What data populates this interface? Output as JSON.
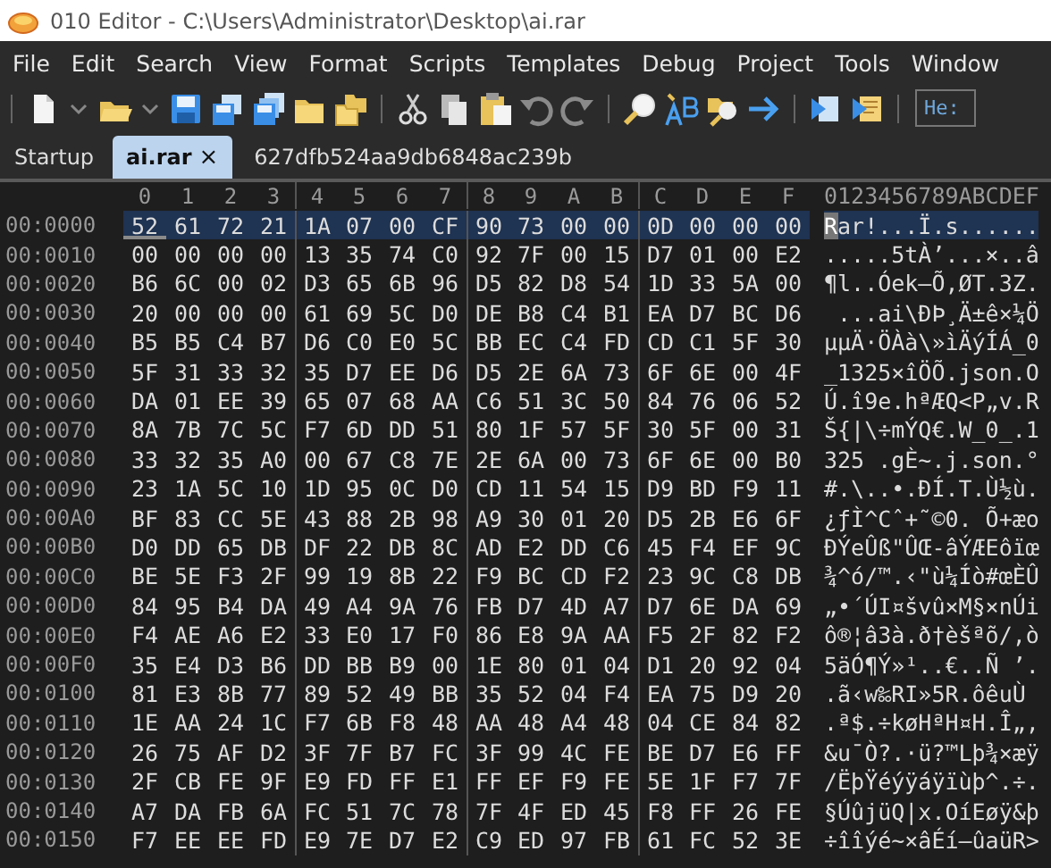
{
  "window": {
    "title": "010 Editor - C:\\Users\\Administrator\\Desktop\\ai.rar"
  },
  "menu": [
    "File",
    "Edit",
    "Search",
    "View",
    "Format",
    "Scripts",
    "Templates",
    "Debug",
    "Project",
    "Tools",
    "Window"
  ],
  "toolbar": {
    "field": "He:"
  },
  "tabs": [
    {
      "label": "Startup",
      "selected": false
    },
    {
      "label": "ai.rar",
      "selected": true,
      "close": "×"
    },
    {
      "label": "627dfb524aa9db6848ac239b",
      "selected": false
    }
  ],
  "hex_view": {
    "columns": [
      "0",
      "1",
      "2",
      "3",
      "4",
      "5",
      "6",
      "7",
      "8",
      "9",
      "A",
      "B",
      "C",
      "D",
      "E",
      "F"
    ],
    "ascii_header": "0123456789ABCDEF",
    "rows": [
      {
        "offset": "00:0000",
        "hex": "52 61 72 21 1A 07 00 CF 90 73 00 00 0D 00 00 00",
        "ascii": "Rar!...Ï.s......",
        "selected": true,
        "cursor": true
      },
      {
        "offset": "00:0010",
        "hex": "00 00 00 00 13 35 74 C0 92 7F 00 15 D7 01 00 E2",
        "ascii": ".....5tÀ’...×..â",
        "selected": false,
        "cursor": false
      },
      {
        "offset": "00:0020",
        "hex": "B6 6C 00 02 D3 65 6B 96 D5 82 D8 54 1D 33 5A 00",
        "ascii": "¶l..Óek–Õ‚ØT.3Z.",
        "selected": false,
        "cursor": false
      },
      {
        "offset": "00:0030",
        "hex": "20 00 00 00 61 69 5C D0 DE B8 C4 B1 EA D7 BC D6",
        "ascii": " ...ai\\ÐÞ¸Ä±ê×¼Ö",
        "selected": false,
        "cursor": false
      },
      {
        "offset": "00:0040",
        "hex": "B5 B5 C4 B7 D6 C0 E0 5C BB EC C4 FD CD C1 5F 30",
        "ascii": "µµÄ·ÖÀà\\»ìÄýÍÁ_0",
        "selected": false,
        "cursor": false
      },
      {
        "offset": "00:0050",
        "hex": "5F 31 33 32 35 D7 EE D6 D5 2E 6A 73 6F 6E 00 4F",
        "ascii": "_1325×îÖÕ.json.O",
        "selected": false,
        "cursor": false
      },
      {
        "offset": "00:0060",
        "hex": "DA 01 EE 39 65 07 68 AA C6 51 3C 50 84 76 06 52",
        "ascii": "Ú.î9e.hªÆQ<P„v.R",
        "selected": false,
        "cursor": false
      },
      {
        "offset": "00:0070",
        "hex": "8A 7B 7C 5C F7 6D DD 51 80 1F 57 5F 30 5F 00 31",
        "ascii": "Š{|\\÷mÝQ€.W_0_.1",
        "selected": false,
        "cursor": false
      },
      {
        "offset": "00:0080",
        "hex": "33 32 35 A0 00 67 C8 7E 2E 6A 00 73 6F 6E 00 B0",
        "ascii": "325 .gÈ~.j.son.°",
        "selected": false,
        "cursor": false
      },
      {
        "offset": "00:0090",
        "hex": "23 1A 5C 10 1D 95 0C D0 CD 11 54 15 D9 BD F9 11",
        "ascii": "#.\\..•.ÐÍ.T.Ù½ù.",
        "selected": false,
        "cursor": false
      },
      {
        "offset": "00:00A0",
        "hex": "BF 83 CC 5E 43 88 2B 98 A9 30 01 20 D5 2B E6 6F",
        "ascii": "¿ƒÌ^Cˆ+˜©0. Õ+æo",
        "selected": false,
        "cursor": false
      },
      {
        "offset": "00:00B0",
        "hex": "D0 DD 65 DB DF 22 DB 8C AD E2 DD C6 45 F4 EF 9C",
        "ascii": "ÐÝeÛß\"ÛŒ-âÝÆEôïœ",
        "selected": false,
        "cursor": false
      },
      {
        "offset": "00:00C0",
        "hex": "BE 5E F3 2F 99 19 8B 22 F9 BC CD F2 23 9C C8 DB",
        "ascii": "¾^ó/™.‹\"ù¼Íò#œÈÛ",
        "selected": false,
        "cursor": false
      },
      {
        "offset": "00:00D0",
        "hex": "84 95 B4 DA 49 A4 9A 76 FB D7 4D A7 D7 6E DA 69",
        "ascii": "„•´ÚI¤švû×M§×nÚi",
        "selected": false,
        "cursor": false
      },
      {
        "offset": "00:00E0",
        "hex": "F4 AE A6 E2 33 E0 17 F0 86 E8 9A AA F5 2F 82 F2",
        "ascii": "ô®¦â3à.ð†èšªõ/‚ò",
        "selected": false,
        "cursor": false
      },
      {
        "offset": "00:00F0",
        "hex": "35 E4 D3 B6 DD BB B9 00 1E 80 01 04 D1 20 92 04",
        "ascii": "5äÓ¶Ý»¹..€..Ñ ’.",
        "selected": false,
        "cursor": false
      },
      {
        "offset": "00:0100",
        "hex": "81 E3 8B 77 89 52 49 BB 35 52 04 F4 EA 75 D9 20",
        "ascii": ".ã‹w‰RI»5R.ôêuÙ ",
        "selected": false,
        "cursor": false
      },
      {
        "offset": "00:0110",
        "hex": "1E AA 24 1C F7 6B F8 48 AA 48 A4 48 04 CE 84 82",
        "ascii": ".ª$.÷køHªH¤H.Î„‚",
        "selected": false,
        "cursor": false
      },
      {
        "offset": "00:0120",
        "hex": "26 75 AF D2 3F 7F B7 FC 3F 99 4C FE BE D7 E6 FF",
        "ascii": "&u¯Ò?.·ü?™Lþ¾×æÿ",
        "selected": false,
        "cursor": false
      },
      {
        "offset": "00:0130",
        "hex": "2F CB FE 9F E9 FD FF E1 FF EF F9 FE 5E 1F F7 7F",
        "ascii": "/ËþŸéýÿáÿïùþ^.÷.",
        "selected": false,
        "cursor": false
      },
      {
        "offset": "00:0140",
        "hex": "A7 DA FB 6A FC 51 7C 78 7F 4F ED 45 F8 FF 26 FE",
        "ascii": "§ÚûjüQ|x.OíEøÿ&þ",
        "selected": false,
        "cursor": false
      },
      {
        "offset": "00:0150",
        "hex": "F7 EE EE FD E9 7E D7 E2 C9 ED 97 FB 61 FC 52 3E",
        "ascii": "÷îîýé~×âÉí—ûaüR>",
        "selected": false,
        "cursor": false
      }
    ]
  }
}
